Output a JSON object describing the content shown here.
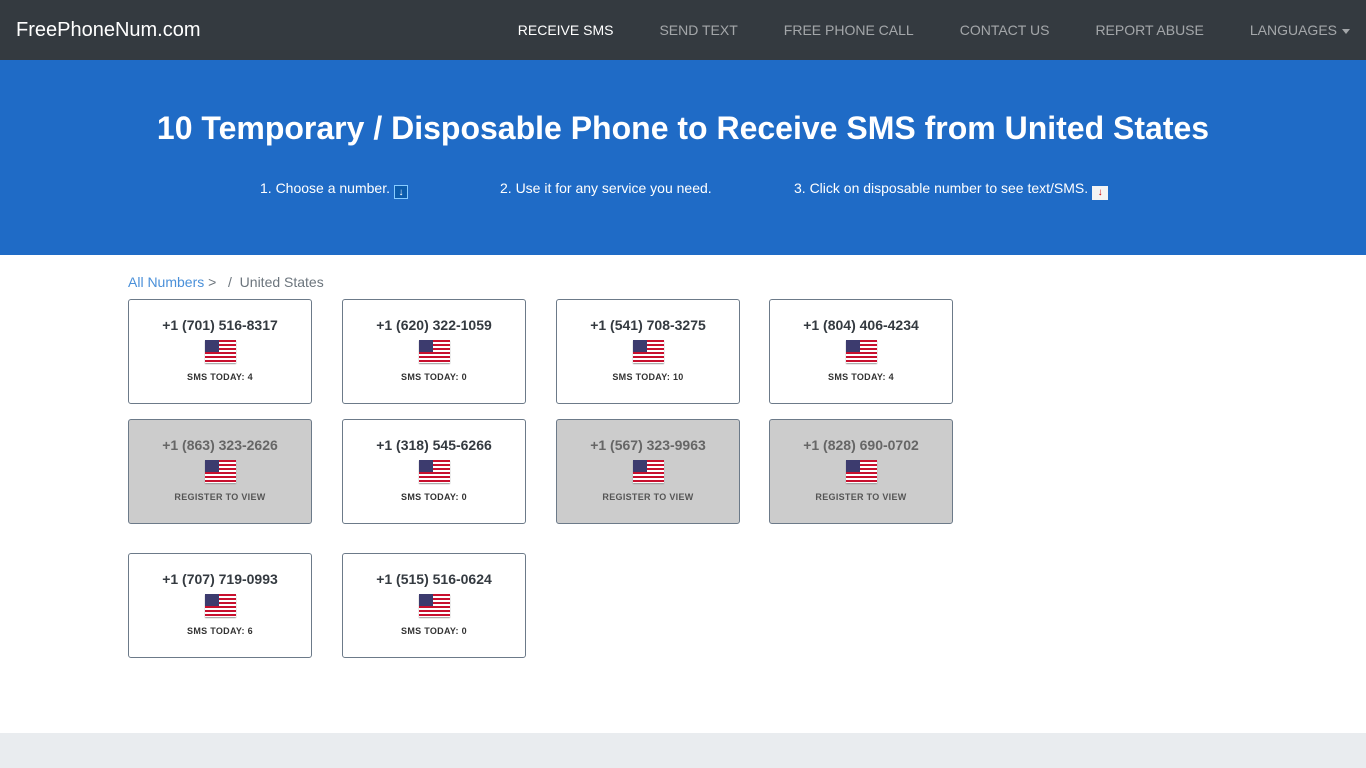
{
  "nav": {
    "brand": "FreePhoneNum.com",
    "items": [
      "RECEIVE SMS",
      "SEND TEXT",
      "FREE PHONE CALL",
      "CONTACT US",
      "REPORT ABUSE",
      "LANGUAGES"
    ]
  },
  "hero": {
    "title": "10 Temporary / Disposable Phone to Receive SMS from United States",
    "step1": "1. Choose a number.",
    "step2": "2. Use it for any service you need.",
    "step3": "3. Click on disposable number to see text/SMS.",
    "step1_icon": "down-arrow-icon",
    "step3_icon": "inbox-tray-icon"
  },
  "breadcrumb": {
    "link": "All Numbers",
    "sep": ">",
    "sep2": "/",
    "current": "United States"
  },
  "cards": [
    {
      "number": "+1 (701) 516-8317",
      "status": "SMS TODAY: 4",
      "locked": false
    },
    {
      "number": "+1 (620) 322-1059",
      "status": "SMS TODAY: 0",
      "locked": false
    },
    {
      "number": "+1 (541) 708-3275",
      "status": "SMS TODAY: 10",
      "locked": false
    },
    {
      "number": "+1 (804) 406-4234",
      "status": "SMS TODAY: 4",
      "locked": false
    },
    {
      "number": "+1 (863) 323-2626",
      "status": "REGISTER TO VIEW",
      "locked": true
    },
    {
      "number": "+1 (318) 545-6266",
      "status": "SMS TODAY: 0",
      "locked": false
    },
    {
      "number": "+1 (567) 323-9963",
      "status": "REGISTER TO VIEW",
      "locked": true
    },
    {
      "number": "+1 (828) 690-0702",
      "status": "REGISTER TO VIEW",
      "locked": true
    },
    {
      "number": "+1 (707) 719-0993",
      "status": "SMS TODAY: 6",
      "locked": false
    },
    {
      "number": "+1 (515) 516-0624",
      "status": "SMS TODAY: 0",
      "locked": false
    }
  ]
}
